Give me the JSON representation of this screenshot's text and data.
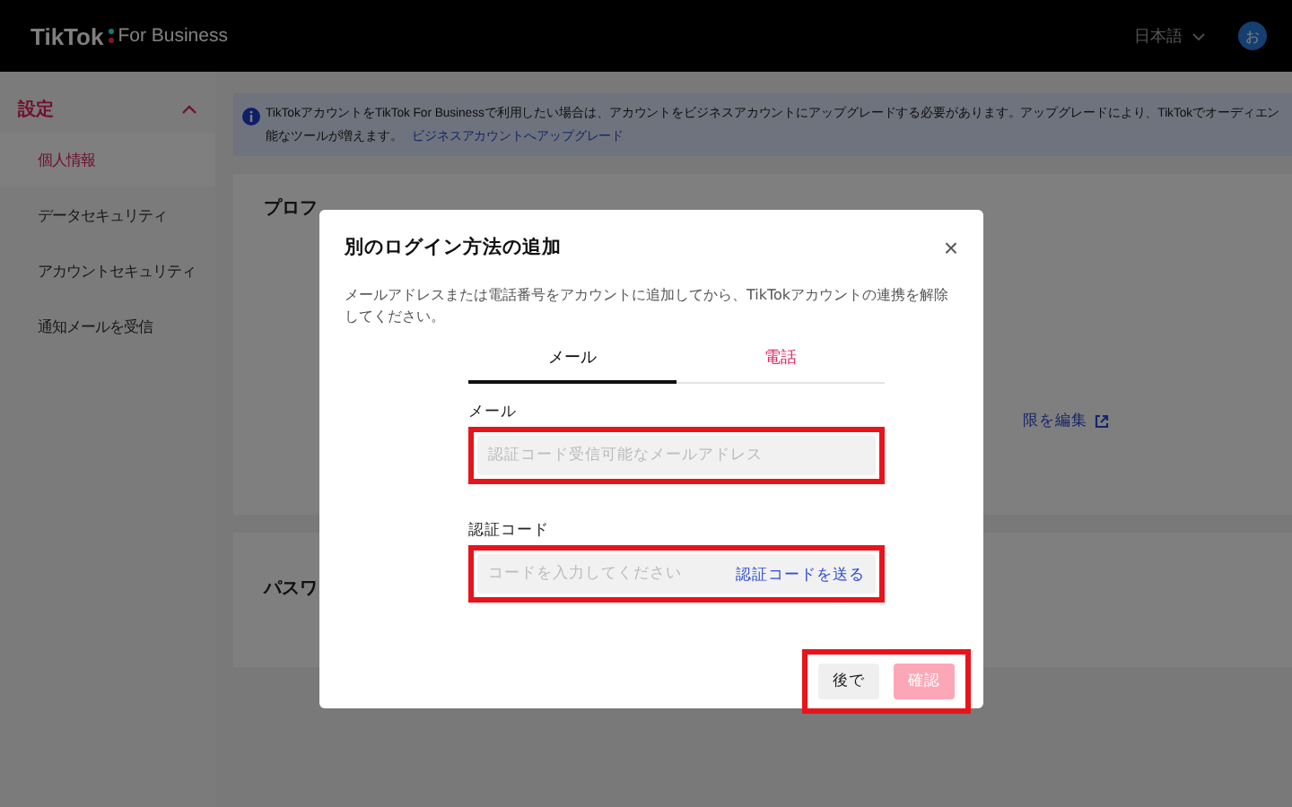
{
  "header": {
    "brand": "TikTok",
    "product": "For Business",
    "language": "日本語",
    "avatar": "お"
  },
  "sidebar": {
    "section": {
      "label": "設定",
      "expanded": true
    },
    "items": [
      {
        "label": "個人情報",
        "selected": true
      },
      {
        "label": "データセキュリティ",
        "selected": false
      },
      {
        "label": "アカウントセキュリティ",
        "selected": false
      },
      {
        "label": "通知メールを受信",
        "selected": false
      }
    ]
  },
  "banner": {
    "line_1": "TikTokアカウントをTikTok For Businessで利用したい場合は、アカウントをビジネスアカウントにアップグレードする必要があります。アップグレードにより、TikTokでオーディエン",
    "line_2": "能なツールが増えます。",
    "link": "ビジネスアカウントへアップグレード"
  },
  "profile_card": {
    "title": "プロフ",
    "link": "限を編集"
  },
  "password_card": {
    "title": "パスワ"
  },
  "dialog": {
    "title": "別のログイン方法の追加",
    "close": "×",
    "description": "メールアドレスまたは電話番号をアカウントに追加してから、TikTokアカウントの連携を解除してください。",
    "tabs": [
      {
        "label": "メール",
        "selected": true
      },
      {
        "label": "電話",
        "selected": false
      }
    ],
    "fields": [
      {
        "label": "メール",
        "placeholder": "認証コード受信可能なメールアドレス"
      },
      {
        "label": "認証コード",
        "placeholder": "コードを入力してください",
        "action": "認証コードを送る"
      }
    ],
    "buttons": [
      {
        "label": "後で",
        "kind": "secondary",
        "disabled": false
      },
      {
        "label": "確認",
        "kind": "primary",
        "disabled": true
      }
    ]
  }
}
